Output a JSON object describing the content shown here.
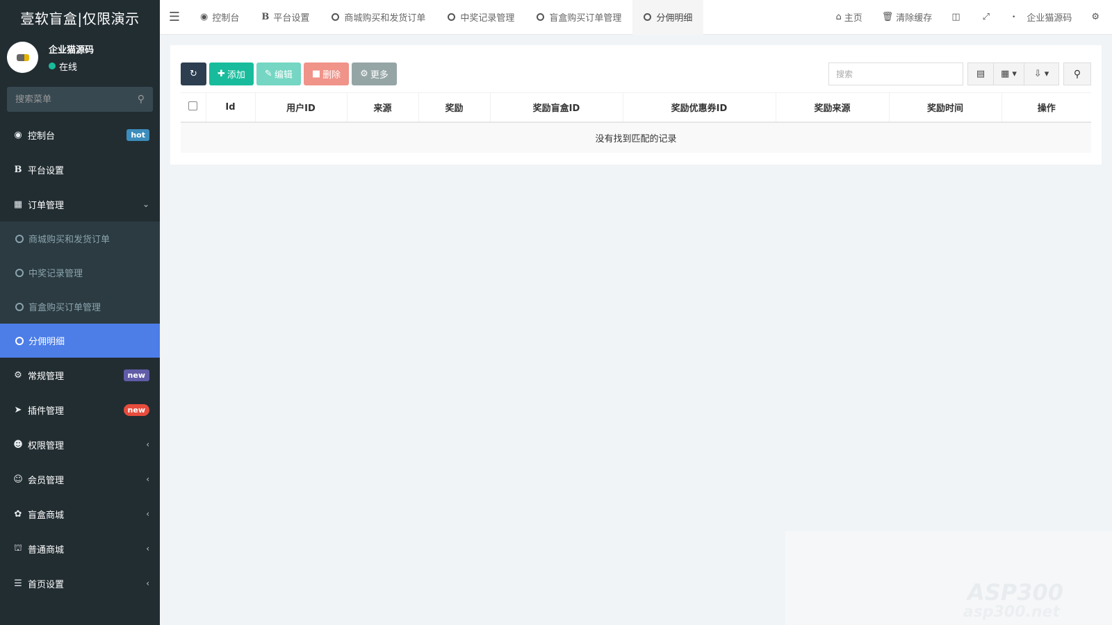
{
  "app": {
    "title": "壹软盲盒|仅限演示"
  },
  "user": {
    "name": "企业猫源码",
    "status": "在线"
  },
  "sidebar": {
    "search_placeholder": "搜索菜单",
    "items": [
      {
        "label": "控制台",
        "icon": "dashboard-icon",
        "badge": "hot"
      },
      {
        "label": "平台设置",
        "icon": "bold-b-icon"
      },
      {
        "label": "订单管理",
        "icon": "calculator-icon",
        "expanded": true
      },
      {
        "label": "常规管理",
        "icon": "gears-icon",
        "badge": "new"
      },
      {
        "label": "插件管理",
        "icon": "rocket-icon",
        "badge": "new"
      },
      {
        "label": "权限管理",
        "icon": "users-icon"
      },
      {
        "label": "会员管理",
        "icon": "user-circle-icon"
      },
      {
        "label": "盲盒商城",
        "icon": "leaf-icon"
      },
      {
        "label": "普通商城",
        "icon": "bank-icon"
      },
      {
        "label": "首页设置",
        "icon": "list-icon"
      }
    ],
    "submenu": [
      {
        "label": "商城购买和发货订单"
      },
      {
        "label": "中奖记录管理"
      },
      {
        "label": "盲盒购买订单管理"
      },
      {
        "label": "分佣明细",
        "active": true
      }
    ]
  },
  "topbar": {
    "tabs": [
      {
        "label": "控制台",
        "icon": "dashboard-icon"
      },
      {
        "label": "平台设置",
        "icon": "bold-b-icon"
      },
      {
        "label": "商城购买和发货订单",
        "icon": "circle-icon"
      },
      {
        "label": "中奖记录管理",
        "icon": "circle-icon"
      },
      {
        "label": "盲盒购买订单管理",
        "icon": "circle-icon"
      },
      {
        "label": "分佣明细",
        "icon": "circle-icon",
        "active": true
      }
    ],
    "home": "主页",
    "clear_cache": "清除缓存",
    "company": "企业猫源码"
  },
  "toolbar": {
    "add": "添加",
    "edit": "编辑",
    "delete": "删除",
    "more": "更多",
    "search_placeholder": "搜索"
  },
  "table": {
    "columns": [
      "Id",
      "用户ID",
      "来源",
      "奖励",
      "奖励盲盒ID",
      "奖励优惠券ID",
      "奖励来源",
      "奖励时间",
      "操作"
    ],
    "empty_text": "没有找到匹配的记录"
  },
  "watermark": {
    "main": "ASP300",
    "sub": "asp300.net"
  },
  "colors": {
    "sidebar_bg": "#222d32",
    "active_item": "#4d7ee8",
    "success": "#18bc9c",
    "danger": "#e74c3c",
    "dark_btn": "#2c3e50"
  }
}
